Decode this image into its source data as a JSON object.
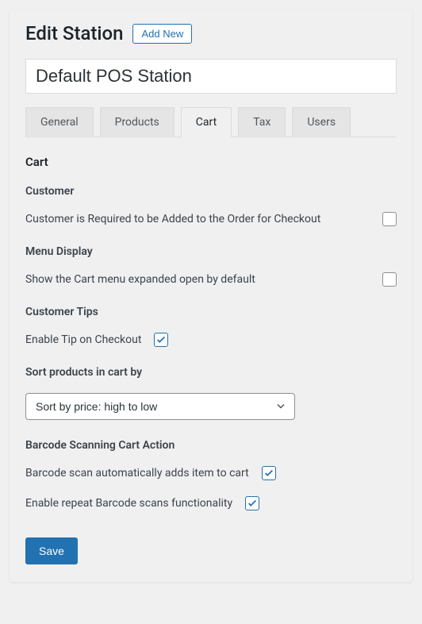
{
  "header": {
    "title": "Edit Station",
    "add_new_label": "Add New"
  },
  "station_name": "Default POS Station",
  "tabs": [
    {
      "label": "General",
      "active": false
    },
    {
      "label": "Products",
      "active": false
    },
    {
      "label": "Cart",
      "active": true
    },
    {
      "label": "Tax",
      "active": false
    },
    {
      "label": "Users",
      "active": false
    }
  ],
  "section": {
    "heading": "Cart",
    "customer": {
      "heading": "Customer",
      "require_customer_label": "Customer is Required to be Added to the Order for Checkout",
      "require_customer_checked": false
    },
    "menu_display": {
      "heading": "Menu Display",
      "expanded_label": "Show the Cart menu expanded open by default",
      "expanded_checked": false
    },
    "customer_tips": {
      "heading": "Customer Tips",
      "enable_tip_label": "Enable Tip on Checkout",
      "enable_tip_checked": true
    },
    "sort": {
      "heading": "Sort products in cart by",
      "selected": "Sort by price: high to low"
    },
    "barcode": {
      "heading": "Barcode Scanning Cart Action",
      "auto_add_label": "Barcode scan automatically adds item to cart",
      "auto_add_checked": true,
      "repeat_label": "Enable repeat Barcode scans functionality",
      "repeat_checked": true
    }
  },
  "save_label": "Save"
}
